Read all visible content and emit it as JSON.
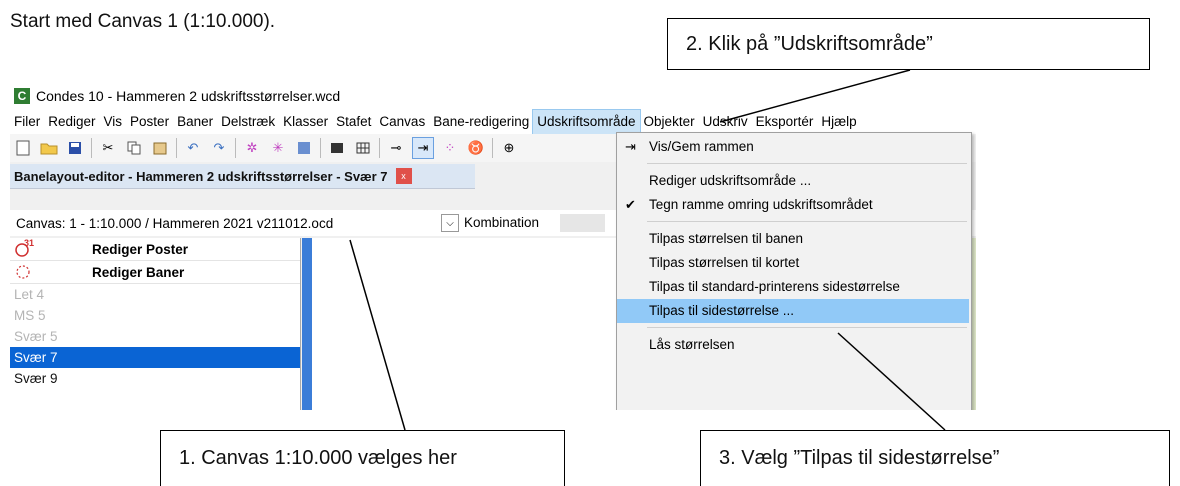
{
  "document": {
    "intro": "Start med Canvas 1 (1:10.000).",
    "callout_1": "1. Canvas 1:10.000 vælges her",
    "callout_2": "2. Klik på ”Udskriftsområde”",
    "callout_3": "3. Vælg ”Tilpas til sidestørrelse”"
  },
  "window": {
    "icon_letter": "C",
    "title": "Condes 10 - Hammeren 2 udskriftsstørrelser.wcd"
  },
  "menubar": {
    "items": [
      "Filer",
      "Rediger",
      "Vis",
      "Poster",
      "Baner",
      "Delstræk",
      "Klasser",
      "Stafet",
      "Canvas",
      "Bane-redigering",
      "Udskriftsområde",
      "Objekter",
      "Udskriv",
      "Eksportér",
      "Hjælp"
    ],
    "active_index": 10
  },
  "editor": {
    "title": "Banelayout-editor - Hammeren 2 udskriftsstørrelser - Svær 7",
    "close_label": "x"
  },
  "canvas_row": {
    "label": "Canvas:  1 - 1:10.000 / Hammeren 2021 v211012.ocd",
    "combination_label": "Kombination",
    "right_fragment": "5("
  },
  "left_panel": {
    "edit_controls": "Rediger Poster",
    "edit_courses": "Rediger Baner",
    "control_badge": "31",
    "courses": [
      {
        "name": "Let 4",
        "state": "dim"
      },
      {
        "name": "MS 5",
        "state": "dim"
      },
      {
        "name": "Svær 5",
        "state": "dim"
      },
      {
        "name": "Svær 7",
        "state": "selected"
      },
      {
        "name": "Svær 9",
        "state": "normal"
      }
    ]
  },
  "dropdown": {
    "items": [
      {
        "label": "Vis/Gem rammen"
      },
      {
        "label": "Rediger udskriftsområde ..."
      },
      {
        "label": "Tegn ramme omring udskriftsområdet",
        "checked": true,
        "check": "✔"
      },
      {
        "label": "Tilpas størrelsen til banen"
      },
      {
        "label": "Tilpas størrelsen til kortet"
      },
      {
        "label": "Tilpas til standard-printerens sidestørrelse"
      },
      {
        "label": "Tilpas til sidestørrelse ...",
        "highlighted": true
      },
      {
        "label": "Lås størrelsen"
      }
    ]
  },
  "colors": {
    "selection_blue": "#0a64d4",
    "menu_highlight": "#91c9f7",
    "close_red": "#e0504a"
  }
}
